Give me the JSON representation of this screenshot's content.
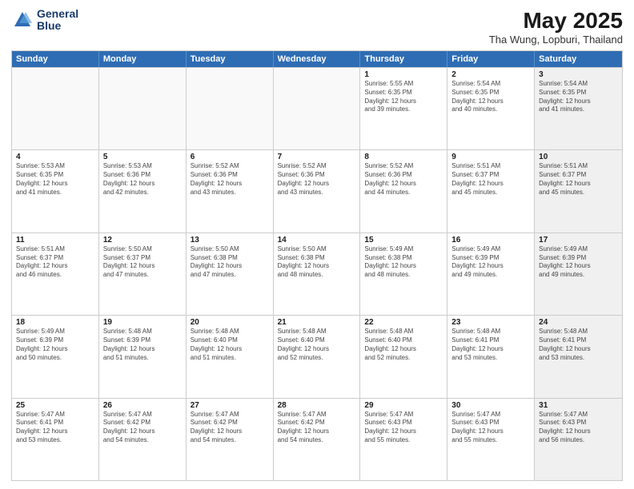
{
  "header": {
    "logo_line1": "General",
    "logo_line2": "Blue",
    "title": "May 2025",
    "location": "Tha Wung, Lopburi, Thailand"
  },
  "days_of_week": [
    "Sunday",
    "Monday",
    "Tuesday",
    "Wednesday",
    "Thursday",
    "Friday",
    "Saturday"
  ],
  "rows": [
    [
      {
        "day": "",
        "info": "",
        "empty": true
      },
      {
        "day": "",
        "info": "",
        "empty": true
      },
      {
        "day": "",
        "info": "",
        "empty": true
      },
      {
        "day": "",
        "info": "",
        "empty": true
      },
      {
        "day": "1",
        "info": "Sunrise: 5:55 AM\nSunset: 6:35 PM\nDaylight: 12 hours\nand 39 minutes."
      },
      {
        "day": "2",
        "info": "Sunrise: 5:54 AM\nSunset: 6:35 PM\nDaylight: 12 hours\nand 40 minutes."
      },
      {
        "day": "3",
        "info": "Sunrise: 5:54 AM\nSunset: 6:35 PM\nDaylight: 12 hours\nand 41 minutes.",
        "shaded": true
      }
    ],
    [
      {
        "day": "4",
        "info": "Sunrise: 5:53 AM\nSunset: 6:35 PM\nDaylight: 12 hours\nand 41 minutes."
      },
      {
        "day": "5",
        "info": "Sunrise: 5:53 AM\nSunset: 6:36 PM\nDaylight: 12 hours\nand 42 minutes."
      },
      {
        "day": "6",
        "info": "Sunrise: 5:52 AM\nSunset: 6:36 PM\nDaylight: 12 hours\nand 43 minutes."
      },
      {
        "day": "7",
        "info": "Sunrise: 5:52 AM\nSunset: 6:36 PM\nDaylight: 12 hours\nand 43 minutes."
      },
      {
        "day": "8",
        "info": "Sunrise: 5:52 AM\nSunset: 6:36 PM\nDaylight: 12 hours\nand 44 minutes."
      },
      {
        "day": "9",
        "info": "Sunrise: 5:51 AM\nSunset: 6:37 PM\nDaylight: 12 hours\nand 45 minutes."
      },
      {
        "day": "10",
        "info": "Sunrise: 5:51 AM\nSunset: 6:37 PM\nDaylight: 12 hours\nand 45 minutes.",
        "shaded": true
      }
    ],
    [
      {
        "day": "11",
        "info": "Sunrise: 5:51 AM\nSunset: 6:37 PM\nDaylight: 12 hours\nand 46 minutes."
      },
      {
        "day": "12",
        "info": "Sunrise: 5:50 AM\nSunset: 6:37 PM\nDaylight: 12 hours\nand 47 minutes."
      },
      {
        "day": "13",
        "info": "Sunrise: 5:50 AM\nSunset: 6:38 PM\nDaylight: 12 hours\nand 47 minutes."
      },
      {
        "day": "14",
        "info": "Sunrise: 5:50 AM\nSunset: 6:38 PM\nDaylight: 12 hours\nand 48 minutes."
      },
      {
        "day": "15",
        "info": "Sunrise: 5:49 AM\nSunset: 6:38 PM\nDaylight: 12 hours\nand 48 minutes."
      },
      {
        "day": "16",
        "info": "Sunrise: 5:49 AM\nSunset: 6:39 PM\nDaylight: 12 hours\nand 49 minutes."
      },
      {
        "day": "17",
        "info": "Sunrise: 5:49 AM\nSunset: 6:39 PM\nDaylight: 12 hours\nand 49 minutes.",
        "shaded": true
      }
    ],
    [
      {
        "day": "18",
        "info": "Sunrise: 5:49 AM\nSunset: 6:39 PM\nDaylight: 12 hours\nand 50 minutes."
      },
      {
        "day": "19",
        "info": "Sunrise: 5:48 AM\nSunset: 6:39 PM\nDaylight: 12 hours\nand 51 minutes."
      },
      {
        "day": "20",
        "info": "Sunrise: 5:48 AM\nSunset: 6:40 PM\nDaylight: 12 hours\nand 51 minutes."
      },
      {
        "day": "21",
        "info": "Sunrise: 5:48 AM\nSunset: 6:40 PM\nDaylight: 12 hours\nand 52 minutes."
      },
      {
        "day": "22",
        "info": "Sunrise: 5:48 AM\nSunset: 6:40 PM\nDaylight: 12 hours\nand 52 minutes."
      },
      {
        "day": "23",
        "info": "Sunrise: 5:48 AM\nSunset: 6:41 PM\nDaylight: 12 hours\nand 53 minutes."
      },
      {
        "day": "24",
        "info": "Sunrise: 5:48 AM\nSunset: 6:41 PM\nDaylight: 12 hours\nand 53 minutes.",
        "shaded": true
      }
    ],
    [
      {
        "day": "25",
        "info": "Sunrise: 5:47 AM\nSunset: 6:41 PM\nDaylight: 12 hours\nand 53 minutes."
      },
      {
        "day": "26",
        "info": "Sunrise: 5:47 AM\nSunset: 6:42 PM\nDaylight: 12 hours\nand 54 minutes."
      },
      {
        "day": "27",
        "info": "Sunrise: 5:47 AM\nSunset: 6:42 PM\nDaylight: 12 hours\nand 54 minutes."
      },
      {
        "day": "28",
        "info": "Sunrise: 5:47 AM\nSunset: 6:42 PM\nDaylight: 12 hours\nand 54 minutes."
      },
      {
        "day": "29",
        "info": "Sunrise: 5:47 AM\nSunset: 6:43 PM\nDaylight: 12 hours\nand 55 minutes."
      },
      {
        "day": "30",
        "info": "Sunrise: 5:47 AM\nSunset: 6:43 PM\nDaylight: 12 hours\nand 55 minutes."
      },
      {
        "day": "31",
        "info": "Sunrise: 5:47 AM\nSunset: 6:43 PM\nDaylight: 12 hours\nand 56 minutes.",
        "shaded": true
      }
    ]
  ]
}
